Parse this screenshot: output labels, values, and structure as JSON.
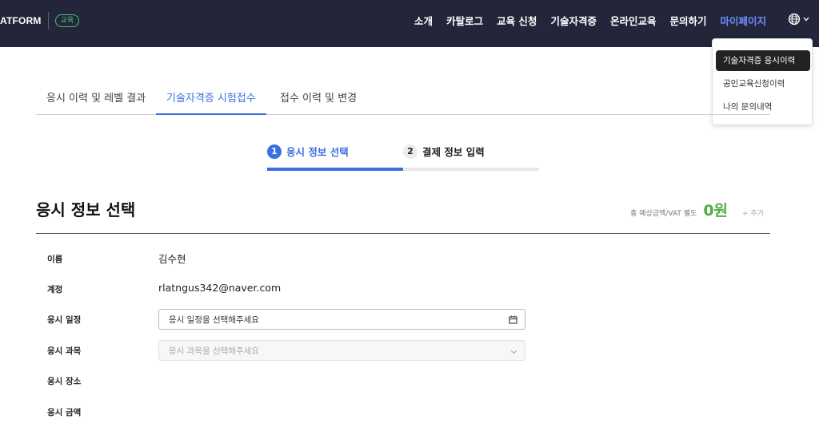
{
  "header": {
    "brand_text": "ATFORM",
    "brand_badge": "교육",
    "nav": [
      "소개",
      "카탈로그",
      "교육 신청",
      "기술자격증",
      "온라인교육",
      "문의하기",
      "마이페이지"
    ],
    "active_nav": "마이페이지",
    "globe_icon": "globe-icon",
    "colors": {
      "header_bg": "#23263a",
      "active_nav": "#6d8dff",
      "badge": "#46c27a"
    }
  },
  "dropdown": {
    "items": [
      "기술자격증 응시이력",
      "공인교육신청이력",
      "나의 문의내역"
    ],
    "selected": "기술자격증 응시이력"
  },
  "tabs": {
    "items": [
      "응시 이력 및 레벨 결과",
      "기술자격증 시험접수",
      "접수 이력 및 변경"
    ],
    "active": "기술자격증 시험접수",
    "accent": "#3b6ee0"
  },
  "steps": {
    "items": [
      {
        "num": "1",
        "label": "응시 정보 선택"
      },
      {
        "num": "2",
        "label": "결제 정보 입력"
      }
    ],
    "current": 1,
    "progress": 0.5
  },
  "section": {
    "title": "응시 정보 선택",
    "total_label": "총 예상금액/VAT 별도",
    "total_value": "0원",
    "add_label": "+ 추가"
  },
  "form": {
    "name_label": "이름",
    "name_value": "김수현",
    "account_label": "계정",
    "account_value": "rlatngus342@naver.com",
    "schedule_label": "응시 일정",
    "schedule_placeholder": "응시 일정을 선택해주세요",
    "subject_label": "응시 과목",
    "subject_placeholder": "응시 과목을 선택해주세요",
    "venue_label": "응시 장소",
    "fee_label": "응시 금액"
  }
}
